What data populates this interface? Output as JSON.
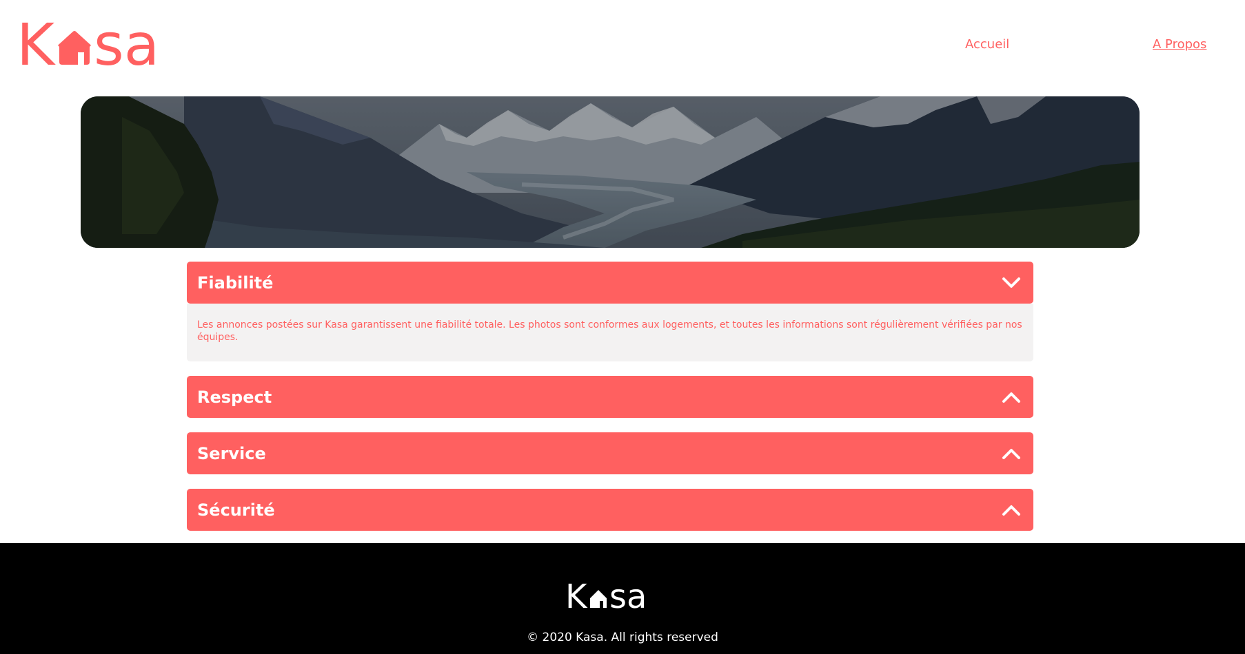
{
  "brand": {
    "name_left": "K",
    "name_right": "sa",
    "color": "#ff6060"
  },
  "nav": {
    "home": "Accueil",
    "about": "A Propos"
  },
  "banner": {
    "image": "mountain-valley-landscape"
  },
  "collapses": [
    {
      "title": "Fiabilité",
      "expanded": true,
      "text": "Les annonces postées sur Kasa garantissent une fiabilité totale. Les photos sont conformes aux logements, et toutes les informations sont régulièrement vérifiées par nos équipes."
    },
    {
      "title": "Respect",
      "expanded": false
    },
    {
      "title": "Service",
      "expanded": false
    },
    {
      "title": "Sécurité",
      "expanded": false
    }
  ],
  "footer": {
    "brand_left": "K",
    "brand_right": "sa",
    "copyright": "© 2020 Kasa. All rights reserved"
  }
}
